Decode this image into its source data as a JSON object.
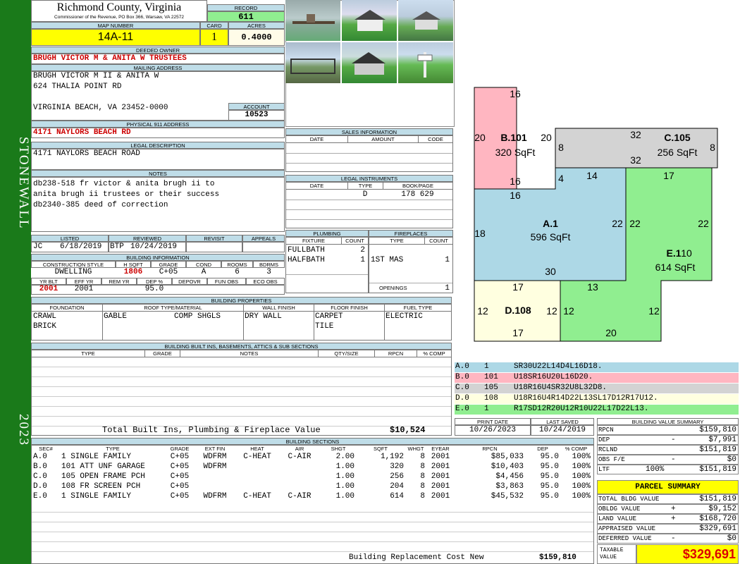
{
  "sidebar": {
    "district": "STONEWALL",
    "year": "2023"
  },
  "header": {
    "county": "Richmond County, Virginia",
    "commissioner": "Commissioner of the Revenue, PO Box 366, Warsaw, VA 22572",
    "record_label": "RECORD",
    "record": "611",
    "map_label": "MAP NUMBER",
    "map": "14A-11",
    "card_label": "CARD",
    "card": "1",
    "acres_label": "ACRES",
    "acres": "0.4000"
  },
  "owner": {
    "deeded_label": "DEEDED OWNER",
    "deeded": "BRUGH VICTOR M & ANITA W TRUSTEES",
    "mailing_label": "MAILING ADDRESS",
    "mailing1": "BRUGH VICTOR M II & ANITA W",
    "mailing2": "624 THALIA POINT RD",
    "mailing3": "VIRGINIA BEACH, VA 23452-0000",
    "account_label": "ACCOUNT",
    "account": "10523",
    "physical_label": "PHYSICAL 911 ADDRESS",
    "physical": "4171 NAYLORS BEACH RD",
    "legal_label": "LEGAL DESCRIPTION",
    "legal": "4171 NAYLORS BEACH ROAD",
    "notes_label": "NOTES",
    "notes1": "db238-518 fr victor & anita brugh ii to",
    "notes2": "anita brugh ii trustees or their success",
    "notes3": "db2340-385 deed of correction"
  },
  "review": {
    "listed_label": "LISTED",
    "reviewed_label": "REVIEWED",
    "revisit_label": "REVISIT",
    "appeals_label": "APPEALS",
    "listed_by": "JC",
    "listed_date": "6/18/2019",
    "reviewed_by": "BTP",
    "reviewed_date": "10/24/2019"
  },
  "building_info": {
    "title": "BUILDING INFORMATION",
    "h1": "CONSTRUCTION STYLE",
    "h2": "H SQFT",
    "h3": "GRADE",
    "h4": "COND",
    "h5": "ROOMS",
    "h6": "BDRMS",
    "style": "DWELLING",
    "hsqft": "1806",
    "grade": "C+05",
    "cond": "A",
    "rooms": "6",
    "bdrms": "3",
    "g1": "YR BLT",
    "g2": "EFF YR",
    "g3": "REM YR",
    "g4": "DEP %",
    "g5": "DEPOVR",
    "g6": "FUN OBS",
    "g7": "ECO OBS",
    "yrblt": "2001",
    "effyr": "2001",
    "dep": "95.0"
  },
  "sales": {
    "title": "SALES INFORMATION",
    "h1": "DATE",
    "h2": "AMOUNT",
    "h3": "CODE"
  },
  "legal_instr": {
    "title": "LEGAL INSTRUMENTS",
    "h1": "DATE",
    "h2": "TYPE",
    "h3": "BOOK/PAGE",
    "type": "D",
    "book": "178 629"
  },
  "plumbing": {
    "title": "PLUMBING",
    "h1": "FIXTURE",
    "h2": "COUNT",
    "r1": "FULLBATH",
    "r1c": "2",
    "r2": "HALFBATH",
    "r2c": "1"
  },
  "fireplaces": {
    "title": "FIREPLACES",
    "h1": "TYPE",
    "h2": "COUNT",
    "r1": "1ST MAS",
    "r1c": "1",
    "openings_label": "OPENINGS",
    "openings": "1"
  },
  "properties": {
    "title": "BUILDING PROPERTIES",
    "h1": "FOUNDATION",
    "h2": "ROOF TYPE/MATERIAL",
    "h3": "WALL FINISH",
    "h4": "FLOOR FINISH",
    "h5": "FUEL TYPE",
    "found1": "CRAWL",
    "found2": "BRICK",
    "roof1": "GABLE",
    "roof2": "COMP SHGLS",
    "wall": "DRY WALL",
    "floor1": "CARPET",
    "floor2": "TILE",
    "fuel": "ELECTRIC"
  },
  "builtins": {
    "title": "BUILDING BUILT INS, BASEMENTS, ATTICS & SUB SECTIONS",
    "h1": "TYPE",
    "h2": "GRADE",
    "h3": "NOTES",
    "h4": "QTY/SIZE",
    "h5": "RPCN",
    "h6": "% COMP",
    "total_label": "Total Built Ins, Plumbing & Fireplace Value",
    "total": "$10,524"
  },
  "sketch": {
    "labels": [
      {
        "code": "A.0",
        "num": "1",
        "vec": "SR30U22L14D4L16D18."
      },
      {
        "code": "B.0",
        "num": "101",
        "vec": "U18SR16U20L16D20."
      },
      {
        "code": "C.0",
        "num": "105",
        "vec": "U18R16U4SR32U8L32D8."
      },
      {
        "code": "D.0",
        "num": "108",
        "vec": "U18R16U4R14D22L13SL17D12R17U12."
      },
      {
        "code": "E.0",
        "num": "1",
        "vec": "R17SD12R20U12R10U22L17D22L13."
      }
    ],
    "colors": [
      "#add8e6",
      "#ffb6c1",
      "#d3d3d3",
      "#ffffe0",
      "#90ee90"
    ],
    "areas": {
      "a_name": "A.1",
      "a_area": "596 SqFt",
      "b_name": "B.101",
      "b_area": "320 SqFt",
      "c_name": "C.105",
      "c_area": "256 SqFt",
      "d_name": "D.108",
      "d_area": "",
      "e_name": "E.1",
      "e_area": "614 SqFt"
    }
  },
  "print": {
    "print_label": "PRINT DATE",
    "saved_label": "LAST SAVED",
    "print_date": "10/26/2023",
    "saved_date": "10/24/2019"
  },
  "bsections": {
    "title": "BUILDING SECTIONS",
    "headers": [
      "SEC#",
      "TYPE",
      "GRADE",
      "EXT FIN",
      "HEAT",
      "AIR",
      "SHGT",
      "SQFT",
      "WHGT",
      "EYEAR",
      "RPCN",
      "DEP",
      "% COMP"
    ],
    "rows": [
      [
        "A.0",
        "1 SINGLE FAMILY",
        "C+05",
        "WDFRM",
        "C-HEAT",
        "C-AIR",
        "2.00",
        "1,192",
        "8",
        "2001",
        "$85,033",
        "95.0",
        "100%"
      ],
      [
        "B.0",
        "101 ATT UNF GARAGE",
        "C+05",
        "WDFRM",
        "",
        "",
        "1.00",
        "320",
        "8",
        "2001",
        "$10,403",
        "95.0",
        "100%"
      ],
      [
        "C.0",
        "105 OPEN FRAME PCH",
        "C+05",
        "",
        "",
        "",
        "1.00",
        "256",
        "8",
        "2001",
        "$4,456",
        "95.0",
        "100%"
      ],
      [
        "D.0",
        "108 FR SCREEN PCH",
        "C+05",
        "",
        "",
        "",
        "1.00",
        "204",
        "8",
        "2001",
        "$3,863",
        "95.0",
        "100%"
      ],
      [
        "E.0",
        "1 SINGLE FAMILY",
        "C+05",
        "WDFRM",
        "C-HEAT",
        "C-AIR",
        "1.00",
        "614",
        "8",
        "2001",
        "$45,532",
        "95.0",
        "100%"
      ]
    ],
    "total_label": "Building Replacement Cost New",
    "total": "$159,810"
  },
  "bvs": {
    "title": "BUILDING VALUE SUMMARY",
    "rpcn_label": "RPCN",
    "rpcn": "$159,810",
    "dep_label": "DEP",
    "dep_sign": "-",
    "dep": "$7,991",
    "rclnd_label": "RCLND",
    "rclnd": "$151,819",
    "obs_label": "OBS F/E",
    "obs_sign": "-",
    "obs": "$0",
    "ltf_label": "LTF",
    "ltf_pct": "100%",
    "ltf": "$151,819"
  },
  "parcel": {
    "title": "PARCEL SUMMARY",
    "tbv_label": "TOTAL BLDG VALUE",
    "tbv": "$151,819",
    "obldg_label": "OBLDG VALUE",
    "obldg_sign": "+",
    "obldg": "$9,152",
    "land_label": "LAND VALUE",
    "land_sign": "+",
    "land": "$168,720",
    "appr_label": "APPRAISED VALUE",
    "appr": "$329,691",
    "def_label": "DEFERRED VALUE",
    "def_sign": "-",
    "def": "$0",
    "taxable_label1": "TAXABLE",
    "taxable_label2": "VALUE",
    "taxable": "$329,691"
  }
}
